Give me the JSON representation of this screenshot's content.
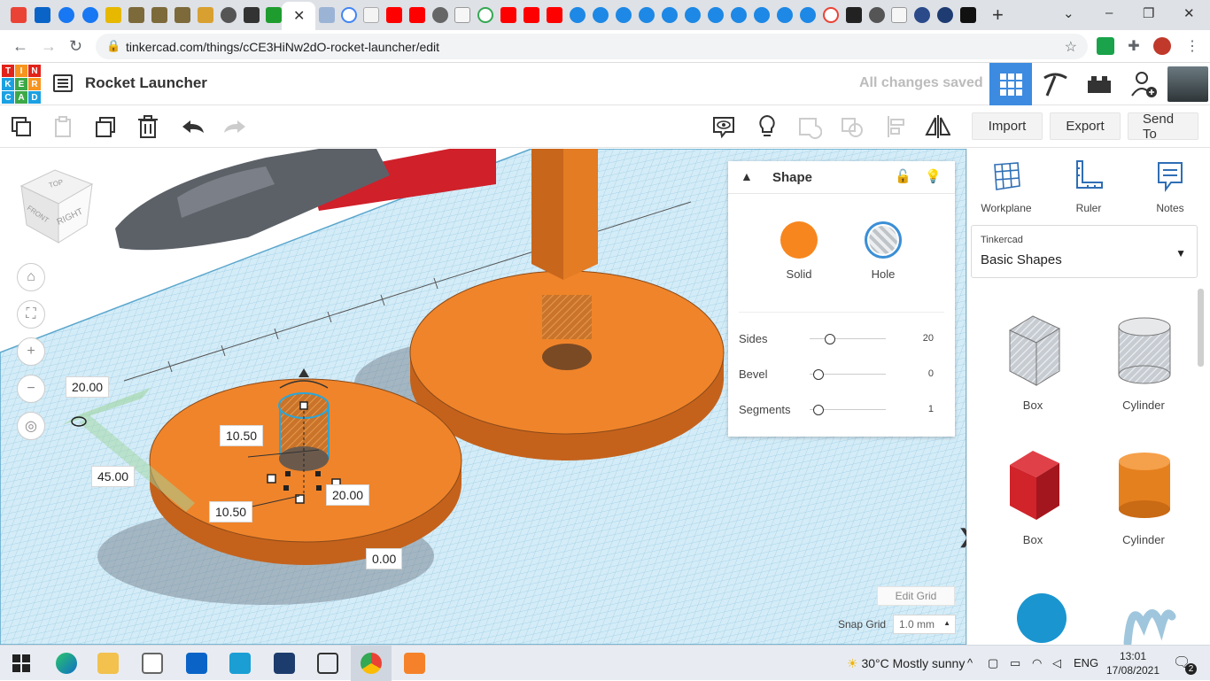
{
  "browser": {
    "url": "tinkercad.com/things/cCE3HiNw2dO-rocket-launcher/edit",
    "active_tab_close": "✕",
    "new_tab": "+",
    "window_controls": [
      "⌄",
      "–",
      "❐",
      "✕"
    ]
  },
  "header": {
    "logo_letters": [
      "T",
      "I",
      "N",
      "K",
      "E",
      "R",
      "C",
      "A",
      "D"
    ],
    "project_title": "Rocket Launcher",
    "save_status": "All changes saved",
    "icons": [
      "grid-view-icon",
      "pickaxe-icon",
      "brick-icon",
      "add-user-icon",
      "avatar"
    ]
  },
  "toolbar": {
    "left_icons": [
      "copy-icon",
      "paste-icon",
      "duplicate-icon",
      "delete-icon",
      "undo-icon",
      "redo-icon"
    ],
    "right_icons": [
      "notes-visibility-icon",
      "lightbulb-icon",
      "group-icon",
      "ungroup-icon",
      "align-icon",
      "mirror-icon"
    ],
    "import_label": "Import",
    "export_label": "Export",
    "send_to_label": "Send To"
  },
  "viewcube": {
    "top": "TOP",
    "front": "FRONT",
    "right": "RIGHT"
  },
  "dimensions": {
    "width_label": "20.00",
    "length_label": "45.00",
    "size_a": "10.50",
    "size_b": "10.50",
    "height": "20.00",
    "elevation": "0.00"
  },
  "inspector": {
    "title": "Shape",
    "solid_label": "Solid",
    "hole_label": "Hole",
    "solid_color": "#f7861e",
    "props": [
      {
        "name": "Sides",
        "value": "20",
        "level": 0.12
      },
      {
        "name": "Bevel",
        "value": "0",
        "level": 0
      },
      {
        "name": "Segments",
        "value": "1",
        "level": 0
      }
    ]
  },
  "grid": {
    "edit_grid_label": "Edit Grid",
    "snap_label": "Snap Grid",
    "snap_value": "1.0 mm"
  },
  "rightpanel": {
    "tools": [
      {
        "label": "Workplane",
        "icon": "workplane-icon"
      },
      {
        "label": "Ruler",
        "icon": "ruler-icon"
      },
      {
        "label": "Notes",
        "icon": "notes-icon"
      }
    ],
    "library_small": "Tinkercad",
    "library_name": "Basic Shapes",
    "shapes": [
      {
        "label": "Box",
        "kind": "box-hole"
      },
      {
        "label": "Cylinder",
        "kind": "cylinder-hole"
      },
      {
        "label": "Box",
        "kind": "box-solid",
        "color": "#d0232a"
      },
      {
        "label": "Cylinder",
        "kind": "cylinder-solid",
        "color": "#e5801f"
      }
    ]
  },
  "taskbar": {
    "weather": "30°C  Mostly sunny",
    "language": "ENG",
    "time": "13:01",
    "date": "17/08/2021",
    "notifications": "2"
  }
}
